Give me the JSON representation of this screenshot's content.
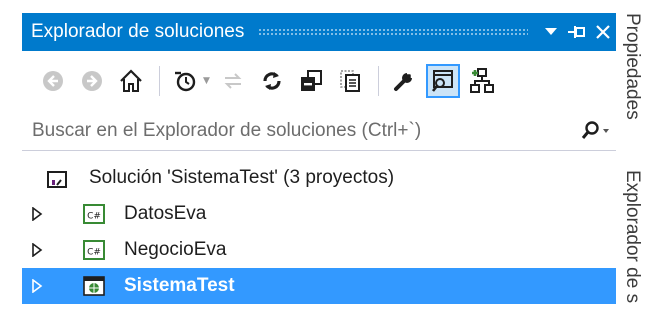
{
  "panel": {
    "title": "Explorador de soluciones",
    "title_buttons": {
      "dropdown": "▾",
      "pin": "⊣",
      "close": "✕"
    }
  },
  "toolbar": {
    "icons": [
      "back-icon",
      "forward-icon",
      "home-icon",
      "pending-changes-filter-icon",
      "sync-icon",
      "refresh-icon",
      "collapse-all-icon",
      "show-all-files-icon",
      "properties-icon",
      "preview-icon",
      "class-view-icon"
    ]
  },
  "search": {
    "placeholder": "Buscar en el Explorador de soluciones (Ctrl+`)"
  },
  "tree": {
    "solution": {
      "label": "Solución 'SistemaTest'  (3 proyectos)"
    },
    "projects": [
      {
        "label": "DatosEva",
        "icon": "csharp-project-icon",
        "selected": false
      },
      {
        "label": "NegocioEva",
        "icon": "csharp-project-icon",
        "selected": false
      },
      {
        "label": "SistemaTest",
        "icon": "web-project-icon",
        "selected": true
      }
    ]
  },
  "side_tabs": [
    "Propiedades",
    "Explorador de s"
  ],
  "colors": {
    "accent": "#007acc",
    "selection": "#3399ff",
    "toolbar_selected_bg": "#cce4f7"
  }
}
